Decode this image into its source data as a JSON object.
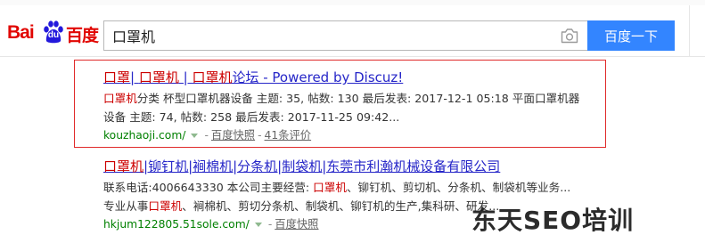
{
  "search": {
    "query": "口罩机",
    "button_label": "百度一下"
  },
  "logo": {
    "text_latin": "Bai",
    "text_du": "du",
    "text_cn": "百度"
  },
  "results": [
    {
      "title_parts": [
        {
          "text": "口罩",
          "hl": true
        },
        {
          "text": "| ",
          "hl": false
        },
        {
          "text": "口罩机",
          "hl": true
        },
        {
          "text": " | ",
          "hl": false
        },
        {
          "text": "口罩机",
          "hl": true
        },
        {
          "text": "论坛 - Powered by Discuz!",
          "hl": false
        }
      ],
      "abstract_lines": [
        [
          {
            "text": "口罩机",
            "hl": true
          },
          {
            "text": "分类 杯型口罩机器设备 主题: 35, 帖数: 130 最后发表: 2017-12-1 05:18 平面口罩机器",
            "hl": false
          }
        ],
        [
          {
            "text": "设备 主题: 74, 帖数: 258 最后发表: 2017-11-25 09:42...",
            "hl": false
          }
        ]
      ],
      "url": "kouzhaoji.com/",
      "links": [
        "百度快照",
        "41条评价"
      ]
    },
    {
      "title_parts": [
        {
          "text": "口罩机",
          "hl": true
        },
        {
          "text": "|铆钉机|裥棉机|分条机|制袋机|东莞市利瀚机械设备有限公司",
          "hl": false
        }
      ],
      "abstract_lines": [
        [
          {
            "text": "联系电话:4006643330 本公司主要经营: ",
            "hl": false
          },
          {
            "text": "口罩机",
            "hl": true
          },
          {
            "text": "、铆钉机、剪切机、分条机、制袋机等业务...",
            "hl": false
          }
        ],
        [
          {
            "text": "专业从事",
            "hl": false
          },
          {
            "text": "口罩机",
            "hl": true
          },
          {
            "text": "、裥棉机、剪切分条机、制袋机、铆钉机的生产,集科研、研发...",
            "hl": false
          }
        ]
      ],
      "url": "hkjum122805.51sole.com/",
      "links": [
        "百度快照"
      ]
    }
  ],
  "watermark": "东天SEO培训",
  "colors": {
    "brand_red": "#e10602",
    "button_blue": "#3385ff",
    "link_blue": "#2626c8",
    "highlight_red": "#cc0000",
    "url_green": "#008000",
    "frame_red": "#e02a2a"
  },
  "icons": {
    "camera": "camera-icon",
    "paw": "paw-icon"
  }
}
